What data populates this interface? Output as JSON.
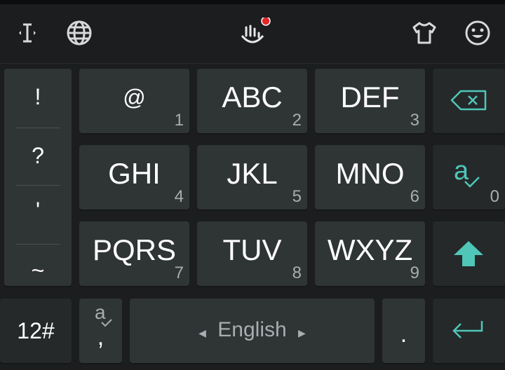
{
  "accent_color": "#4fc6b8",
  "notification_color": "#e3262b",
  "toolbar": {
    "icons": [
      "text-cursor-icon",
      "globe-icon",
      "touchpal-gesture-icon",
      "tshirt-theme-icon",
      "smiley-emoji-icon"
    ]
  },
  "symbols": [
    "!",
    "?",
    "'",
    "~"
  ],
  "keys": [
    {
      "label": "@",
      "num": "1"
    },
    {
      "label": "ABC",
      "num": "2"
    },
    {
      "label": "DEF",
      "num": "3"
    },
    {
      "label": "GHI",
      "num": "4"
    },
    {
      "label": "JKL",
      "num": "5"
    },
    {
      "label": "MNO",
      "num": "6"
    },
    {
      "label": "PQRS",
      "num": "7"
    },
    {
      "label": "TUV",
      "num": "8"
    },
    {
      "label": "WXYZ",
      "num": "9"
    }
  ],
  "zero_key": {
    "num": "0"
  },
  "bottom": {
    "mode_label": "12#",
    "comma_label": ",",
    "space_label": "English",
    "period_label": "."
  }
}
